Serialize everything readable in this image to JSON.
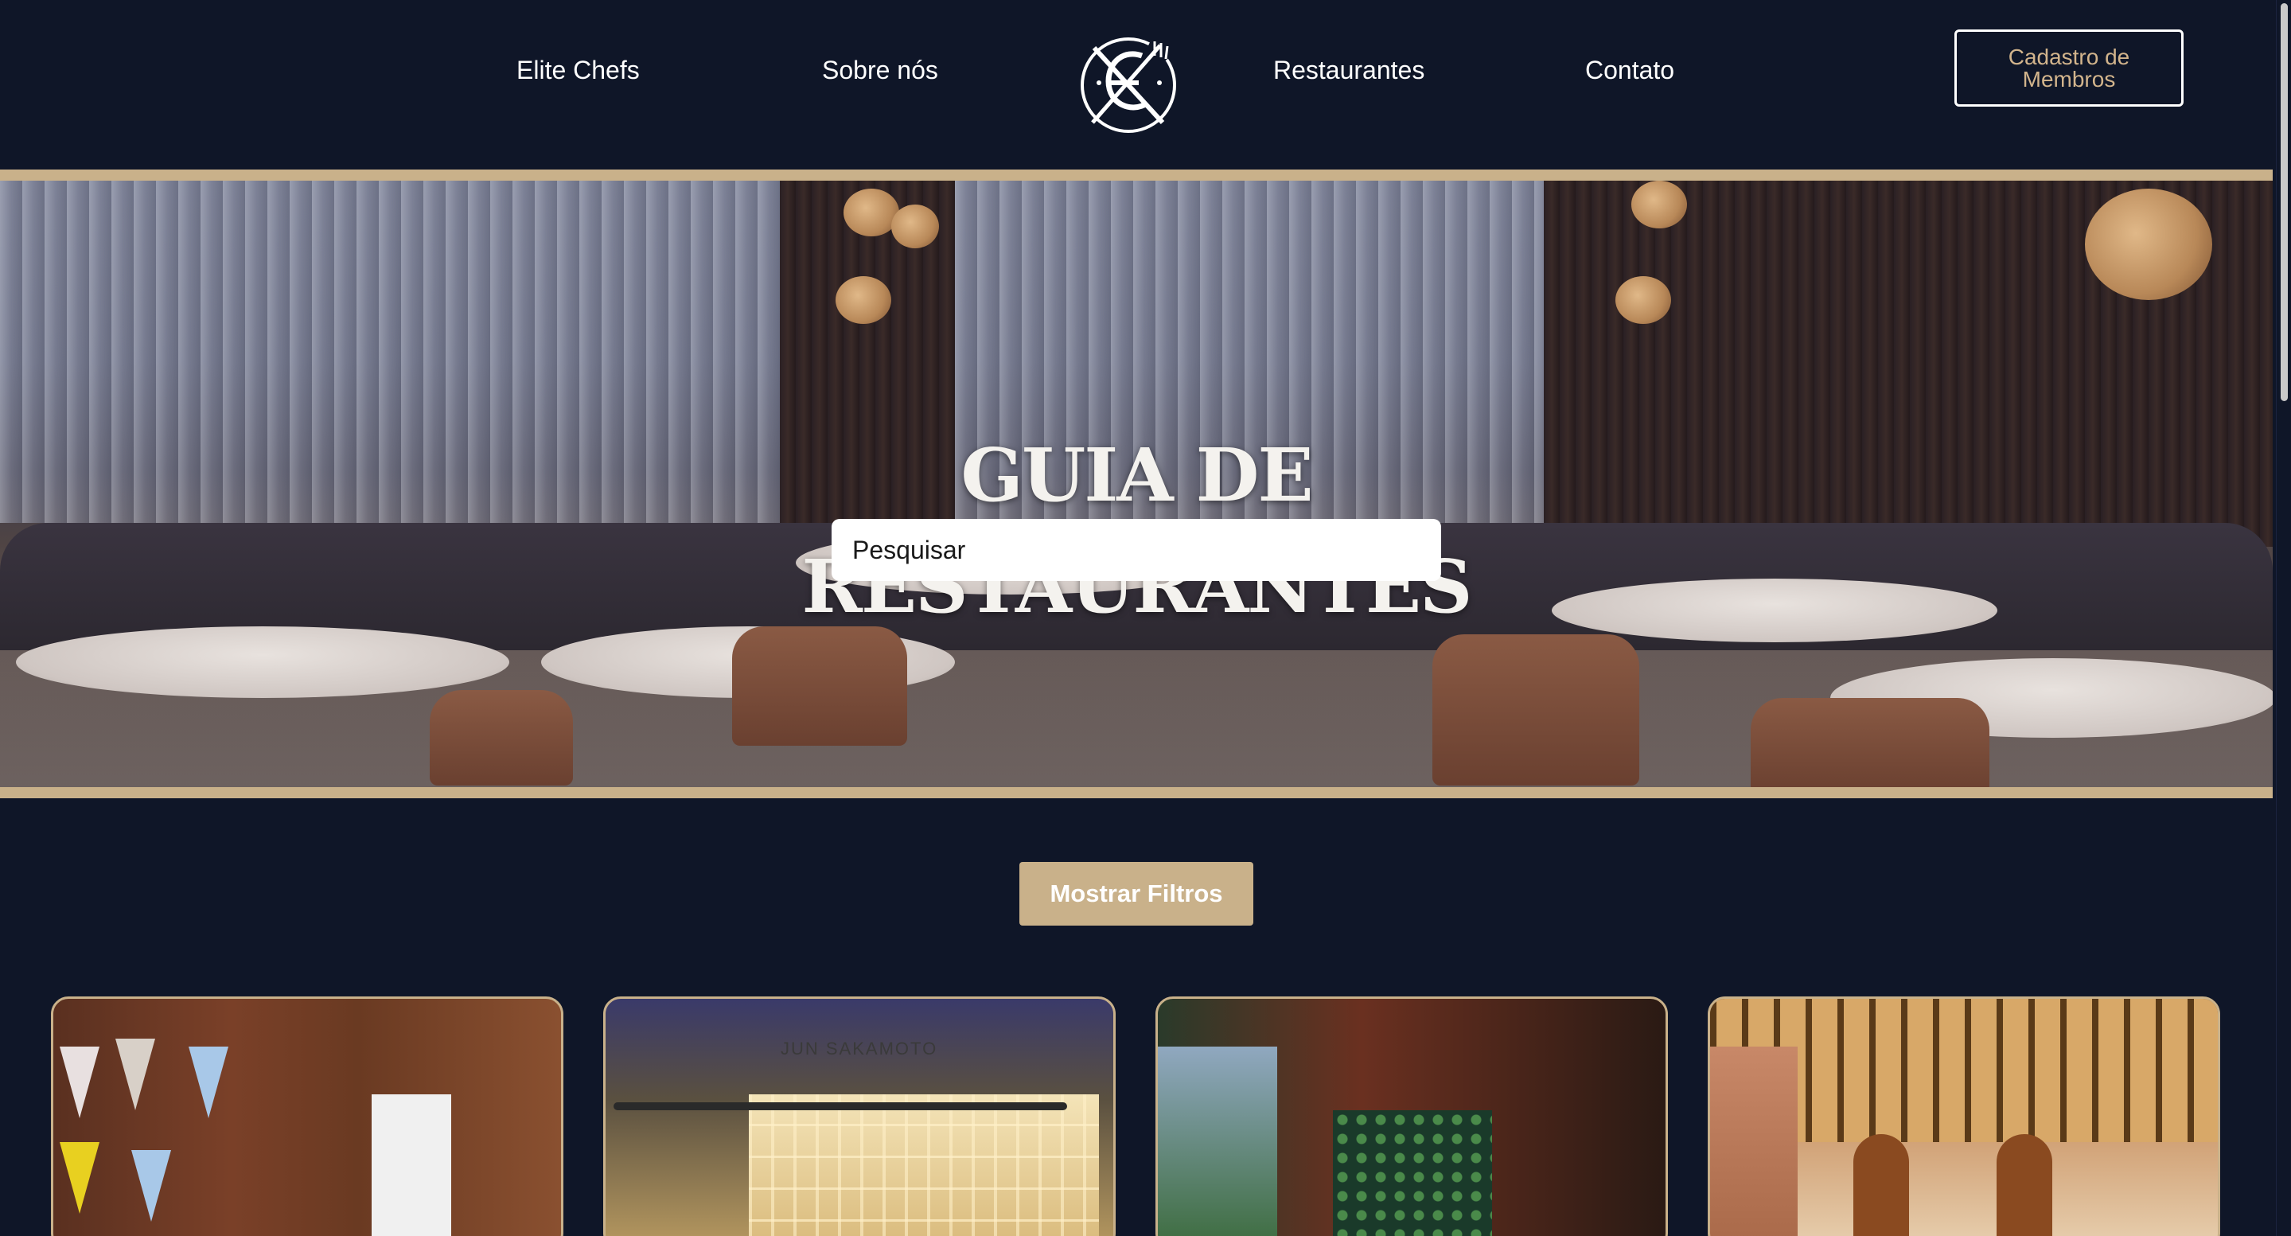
{
  "header": {
    "nav_left": [
      "Elite Chefs",
      "Sobre nós"
    ],
    "nav_right": [
      "Restaurantes",
      "Contato"
    ],
    "member_button": "Cadastro de Membros",
    "logo_icon": "elite-chefs-logo"
  },
  "hero": {
    "title_line1": "GUIA DE",
    "title_line2": "RESTAURANTES",
    "search_placeholder": "Pesquisar"
  },
  "filters": {
    "button_label": "Mostrar Filtros"
  },
  "cards": [
    {
      "image": "restaurant-photo-1"
    },
    {
      "image": "restaurant-photo-2",
      "sign": "JUN SAKAMOTO"
    },
    {
      "image": "restaurant-photo-3"
    },
    {
      "image": "restaurant-photo-4"
    }
  ],
  "colors": {
    "background": "#0f1628",
    "accent": "#c9b18a",
    "member_text": "#d2b48c"
  }
}
